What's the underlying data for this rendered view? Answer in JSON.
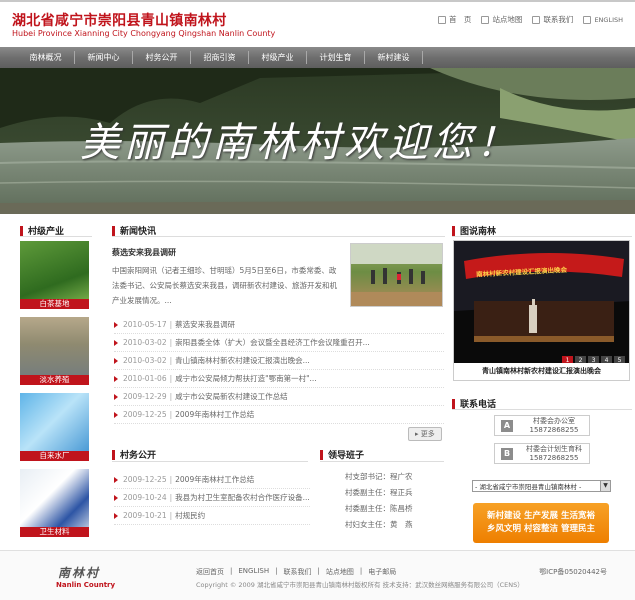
{
  "header": {
    "title": "湖北省咸宁市崇阳县青山镇南林村",
    "subtitle": "Hubei Province Xianning City Chongyang Qingshan Nanlin County",
    "links": [
      {
        "icon": "home-icon",
        "label": "首　页"
      },
      {
        "icon": "sitemap-icon",
        "label": "站点地图"
      },
      {
        "icon": "contact-icon",
        "label": "联系我们"
      },
      {
        "icon": "english-icon",
        "label": "ENGLISH"
      }
    ]
  },
  "nav": [
    "南林概况",
    "新闻中心",
    "村务公开",
    "招商引资",
    "村级产业",
    "计划生育",
    "新村建设"
  ],
  "banner": {
    "slogan": "美丽的南林村欢迎您！"
  },
  "industry": {
    "title": "村级产业",
    "items": [
      "白茶基地",
      "淡水养殖",
      "自来水厂",
      "卫生材料"
    ]
  },
  "news": {
    "title": "新闻快讯",
    "headline": "蔡选安来我县调研",
    "summary": "中国崇阳网讯（记者王细珍、甘明瑶）5月5日至6日，市委常委、政法委书记、公安局长蔡选安来我县，调研新农村建设、旅游开发和机产业发展情况。...",
    "items": [
      {
        "date": "2010-05-17",
        "title": "蔡选安来我县调研"
      },
      {
        "date": "2010-03-02",
        "title": "崇阳县委全体（扩大）会议暨全县经济工作会议隆重召开..."
      },
      {
        "date": "2010-03-02",
        "title": "青山镇南林村新农村建设汇报演出晚会..."
      },
      {
        "date": "2010-01-06",
        "title": "咸宁市公安局倾力帮扶打造\"鄂南第一村\"..."
      },
      {
        "date": "2009-12-29",
        "title": "咸宁市公安局新农村建设工作总结"
      },
      {
        "date": "2009-12-25",
        "title": "2009年南林村工作总结"
      }
    ],
    "more": "更多"
  },
  "village_affairs": {
    "title": "村务公开",
    "items": [
      {
        "date": "2009-12-25",
        "title": "2009年南林村工作总结"
      },
      {
        "date": "2009-10-24",
        "title": "我县为村卫生室配备农村合作医疗设备..."
      },
      {
        "date": "2009-10-21",
        "title": "村规民约"
      }
    ]
  },
  "leaders": {
    "title": "领导班子",
    "items": [
      {
        "role": "村支部书记",
        "name": "程广农"
      },
      {
        "role": "村委副主任",
        "name": "程正兵"
      },
      {
        "role": "村委副主任",
        "name": "陈昌桥"
      },
      {
        "role": "村妇女主任",
        "name": "黄　燕"
      }
    ]
  },
  "gallery": {
    "title": "图说南林",
    "caption": "青山镇南林村新农村建设汇报演出晚会",
    "pages": [
      "1",
      "2",
      "3",
      "4",
      "5"
    ],
    "active_page": "1",
    "stage_banner": "南林村新农村建设汇报演出晚会"
  },
  "contact": {
    "title": "联系电话",
    "items": [
      {
        "letter": "A",
        "name": "村委会办公室",
        "phone": "15872868255"
      },
      {
        "letter": "B",
        "name": "村委会计划生育科",
        "phone": "15872868255"
      }
    ]
  },
  "selector": {
    "value": "- 湖北省咸宁市崇阳县青山镇南林村 -"
  },
  "promo": {
    "line1": [
      "新村建设",
      "生产发展",
      "生活宽裕"
    ],
    "line2": [
      "乡风文明",
      "村容整洁",
      "管理民主"
    ]
  },
  "footer": {
    "logo_cn": "南林村",
    "logo_en": "Nanlin Country",
    "links": [
      "返回首页",
      "ENGLISH",
      "联系我们",
      "站点地图",
      "电子邮局"
    ],
    "icp": "鄂ICP备05020442号",
    "copyright": "Copyright © 2009 湖北省咸宁市崇阳县青山镇南林村版权所有 技术支持：武汉数丝网络服务有限公司（CENS）"
  },
  "colors": {
    "accent": "#c0141c",
    "nav": "#707070",
    "promo": "#f08c00"
  }
}
